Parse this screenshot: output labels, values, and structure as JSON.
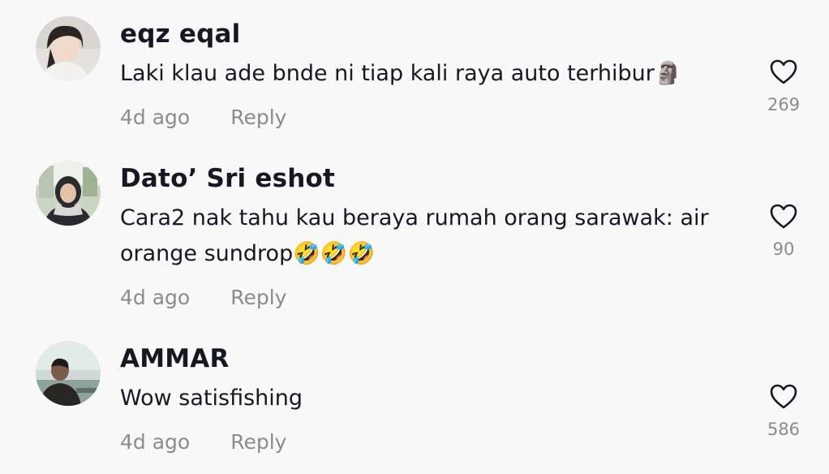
{
  "comments": [
    {
      "username": "eqz eqal",
      "text": "Laki klau ade bnde ni tiap kali raya auto terhibur🗿",
      "time": "4d ago",
      "reply_label": "Reply",
      "likes": "269",
      "avatar_icon": "user-avatar"
    },
    {
      "username": "Dato’ Sri eshot",
      "text": "Cara2 nak tahu kau beraya rumah orang sarawak: air orange sundrop🤣🤣🤣",
      "time": "4d ago",
      "reply_label": "Reply",
      "likes": "90",
      "avatar_icon": "user-avatar"
    },
    {
      "username": "AMMAR",
      "text": "Wow satisfishing",
      "time": "4d ago",
      "reply_label": "Reply",
      "likes": "586",
      "avatar_icon": "user-avatar"
    }
  ],
  "icons": {
    "like": "heart-outline-icon"
  },
  "colors": {
    "background": "#f8f8f8",
    "primary_text": "#161823",
    "secondary_text": "#8a8b91"
  }
}
